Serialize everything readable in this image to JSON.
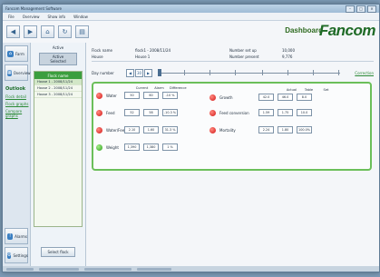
{
  "window": {
    "title": "Fancom Management Software"
  },
  "menu": [
    "File",
    "Overview",
    "Show info",
    "Window"
  ],
  "toolbar": {
    "dashboard_title": "Dashboard",
    "logo": "Fancom"
  },
  "nav": {
    "top_buttons": [
      "Farm",
      "Overview"
    ],
    "section_title": "Outlook",
    "links": [
      "Flock detail",
      "Flock graphs",
      "Compare graphs"
    ],
    "bottom_buttons": [
      "Alarms",
      "Settings"
    ]
  },
  "column": {
    "header": "Active",
    "selected": [
      "Active",
      "Selected"
    ],
    "list_header": "Flock name",
    "rows": [
      "House 1 - 2008/11/24",
      "House 2 - 2008/11/24",
      "House 3 - 2008/11/24"
    ],
    "bottom_button": "Select flock"
  },
  "info": {
    "flock_name_label": "Flock name",
    "flock_name_value": "flock1 - 2008/11/24",
    "house_label": "House",
    "house_value": "House 1",
    "number_set_up_label": "Number set up",
    "number_set_up_value": "10,000",
    "number_present_label": "Number present",
    "number_present_value": "9,776"
  },
  "daybar": {
    "label": "Day number",
    "prev": "◀",
    "day": "30",
    "next": "▶",
    "link": "Correction"
  },
  "panel": {
    "left_headers": [
      "Current",
      "Alarm",
      "Difference"
    ],
    "right_headers": [
      "Actual",
      "Table",
      "Set"
    ],
    "left": [
      {
        "name": "Water",
        "values": [
          "50",
          "60",
          "-10 %"
        ],
        "status": "red"
      },
      {
        "name": "Feed",
        "values": [
          "52",
          "58",
          "-10.3 %"
        ],
        "status": "red"
      },
      {
        "name": "Water/Feed",
        "values": [
          "2.10",
          "1.60",
          "31.3 %"
        ],
        "status": "red"
      },
      {
        "name": "Weight",
        "values": [
          "1,390",
          "1,380",
          "1 %"
        ],
        "status": "green"
      }
    ],
    "right": [
      {
        "name": "Growth",
        "values": [
          "42.0",
          "46.0",
          "8.0"
        ],
        "status": "red"
      },
      {
        "name": "Feed conversion",
        "values": [
          "1.59",
          "1.75",
          "10.0"
        ],
        "status": "red"
      },
      {
        "name": "Mortality",
        "values": [
          "2.24",
          "1.80",
          "100.0%"
        ],
        "status": "red"
      }
    ]
  }
}
